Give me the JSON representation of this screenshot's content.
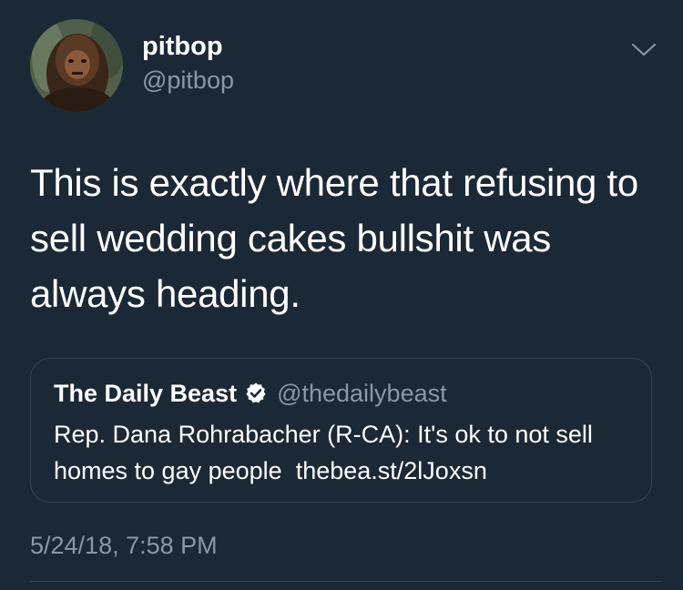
{
  "author": {
    "display_name": "pitbop",
    "handle": "@pitbop"
  },
  "tweet": {
    "text": "This is exactly where that refusing to sell wedding cakes bullshit was always heading.",
    "timestamp": "5/24/18, 7:58 PM"
  },
  "quoted_tweet": {
    "display_name": "The Daily Beast",
    "verified": true,
    "handle": "@thedailybeast",
    "text": "Rep. Dana Rohrabacher (R-CA): It's ok to not sell homes to gay people",
    "link": "thebea.st/2lJoxsn"
  },
  "icons": {
    "menu": "chevron-down-icon",
    "verified": "verified-badge-icon"
  },
  "colors": {
    "background": "#1b2836",
    "primary_text": "#ffffff",
    "secondary_text": "#8899a6",
    "border": "#38444d"
  }
}
